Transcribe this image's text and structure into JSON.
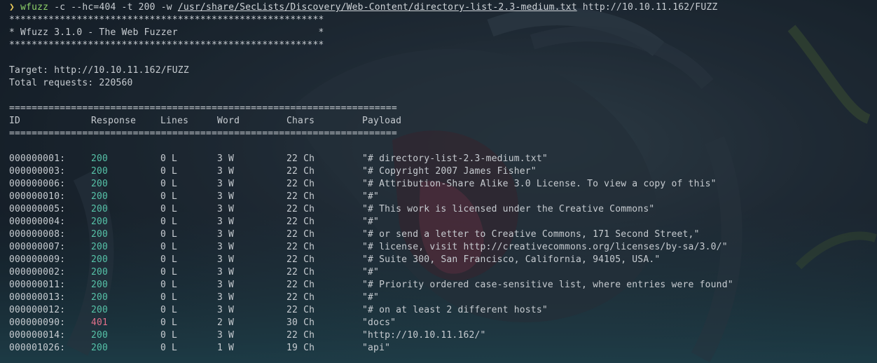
{
  "command": {
    "prompt": "❯",
    "program": "wfuzz",
    "args_before": " -c --hc=404 -t 200 -w ",
    "wordlist": "/usr/share/SecLists/Discovery/Web-Content/directory-list-2.3-medium.txt",
    "url": " http://10.10.11.162/FUZZ"
  },
  "banner": {
    "stars": "********************************************************",
    "title": "* Wfuzz 3.1.0 - The Web Fuzzer                         *",
    "stars2": "********************************************************"
  },
  "info": {
    "target": "Target: http://10.10.11.162/FUZZ",
    "total": "Total requests: 220560"
  },
  "table": {
    "separator": "=====================================================================",
    "headers": {
      "id": "ID",
      "response": "Response",
      "lines": "Lines",
      "word": "Word",
      "chars": "Chars",
      "payload": "Payload"
    },
    "rows": [
      {
        "id": "000000001:",
        "response": "200",
        "lines": "0 L",
        "word": "3 W",
        "chars": "22 Ch",
        "payload": "\"# directory-list-2.3-medium.txt\""
      },
      {
        "id": "000000003:",
        "response": "200",
        "lines": "0 L",
        "word": "3 W",
        "chars": "22 Ch",
        "payload": "\"# Copyright 2007 James Fisher\""
      },
      {
        "id": "000000006:",
        "response": "200",
        "lines": "0 L",
        "word": "3 W",
        "chars": "22 Ch",
        "payload": "\"# Attribution-Share Alike 3.0 License. To view a copy of this\""
      },
      {
        "id": "000000010:",
        "response": "200",
        "lines": "0 L",
        "word": "3 W",
        "chars": "22 Ch",
        "payload": "\"#\""
      },
      {
        "id": "000000005:",
        "response": "200",
        "lines": "0 L",
        "word": "3 W",
        "chars": "22 Ch",
        "payload": "\"# This work is licensed under the Creative Commons\""
      },
      {
        "id": "000000004:",
        "response": "200",
        "lines": "0 L",
        "word": "3 W",
        "chars": "22 Ch",
        "payload": "\"#\""
      },
      {
        "id": "000000008:",
        "response": "200",
        "lines": "0 L",
        "word": "3 W",
        "chars": "22 Ch",
        "payload": "\"# or send a letter to Creative Commons, 171 Second Street,\""
      },
      {
        "id": "000000007:",
        "response": "200",
        "lines": "0 L",
        "word": "3 W",
        "chars": "22 Ch",
        "payload": "\"# license, visit http://creativecommons.org/licenses/by-sa/3.0/\""
      },
      {
        "id": "000000009:",
        "response": "200",
        "lines": "0 L",
        "word": "3 W",
        "chars": "22 Ch",
        "payload": "\"# Suite 300, San Francisco, California, 94105, USA.\""
      },
      {
        "id": "000000002:",
        "response": "200",
        "lines": "0 L",
        "word": "3 W",
        "chars": "22 Ch",
        "payload": "\"#\""
      },
      {
        "id": "000000011:",
        "response": "200",
        "lines": "0 L",
        "word": "3 W",
        "chars": "22 Ch",
        "payload": "\"# Priority ordered case-sensitive list, where entries were found\""
      },
      {
        "id": "000000013:",
        "response": "200",
        "lines": "0 L",
        "word": "3 W",
        "chars": "22 Ch",
        "payload": "\"#\""
      },
      {
        "id": "000000012:",
        "response": "200",
        "lines": "0 L",
        "word": "3 W",
        "chars": "22 Ch",
        "payload": "\"# on at least 2 different hosts\""
      },
      {
        "id": "000000090:",
        "response": "401",
        "lines": "0 L",
        "word": "2 W",
        "chars": "30 Ch",
        "payload": "\"docs\""
      },
      {
        "id": "000000014:",
        "response": "200",
        "lines": "0 L",
        "word": "3 W",
        "chars": "22 Ch",
        "payload": "\"http://10.10.11.162/\""
      },
      {
        "id": "000001026:",
        "response": "200",
        "lines": "0 L",
        "word": "1 W",
        "chars": "19 Ch",
        "payload": "\"api\""
      }
    ]
  },
  "colors": {
    "response_ok": "#56c2a8",
    "response_unauthorized": "#e0708a",
    "prompt": "#e8c95a",
    "command": "#8fd36a"
  }
}
